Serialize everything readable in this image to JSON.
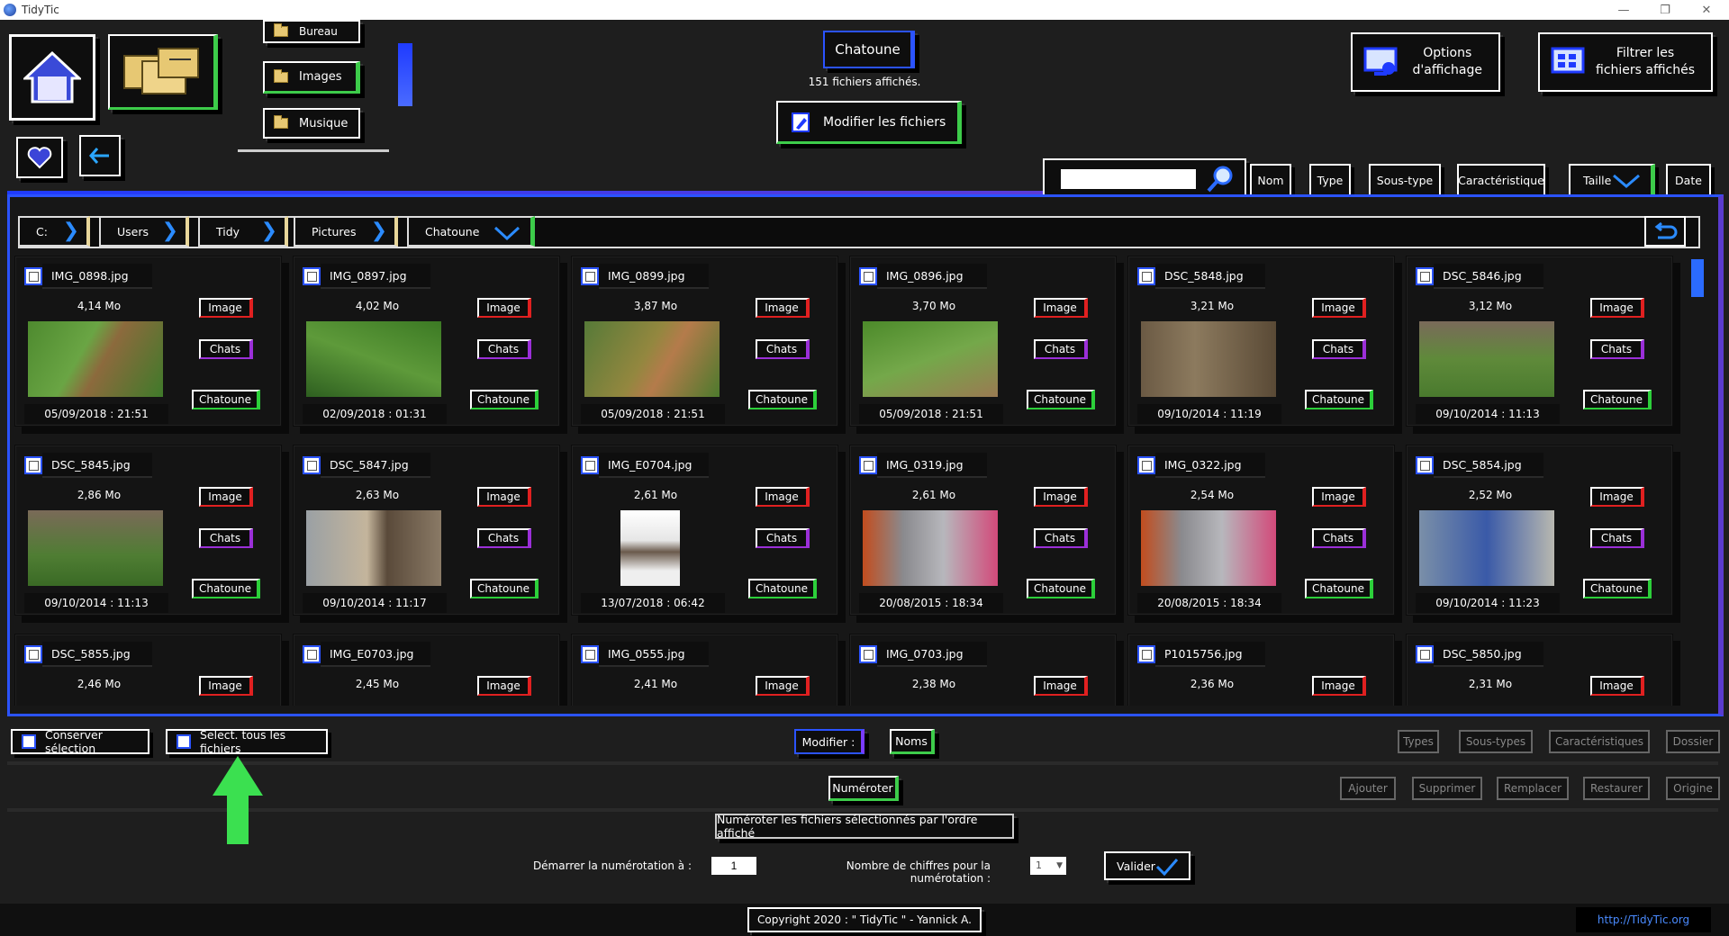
{
  "window": {
    "title": "TidyTic",
    "minimize": "—",
    "restore": "❐",
    "close": "✕"
  },
  "folders": {
    "partial": "Bureau",
    "images": "Images",
    "music": "Musique"
  },
  "current": {
    "folder": "Chatoune",
    "count_label": "151 fichiers affichés.",
    "modify": "Modifier les fichiers"
  },
  "top_right": {
    "display_options": "Options\nd'affichage",
    "filter": "Filtrer les\nfichiers affichés"
  },
  "search": {
    "value": ""
  },
  "sort": {
    "name": "Nom",
    "type": "Type",
    "subtype": "Sous-type",
    "feature": "Caractéristique",
    "size": "Taille",
    "date": "Date"
  },
  "breadcrumb": [
    "C:",
    "Users",
    "Tidy",
    "Pictures",
    "Chatoune"
  ],
  "tags": {
    "type": "Image",
    "subtype": "Chats",
    "feature": "Chatoune"
  },
  "files": [
    {
      "name": "IMG_0898.jpg",
      "size": "4,14 Mo",
      "date": "05/09/2018 : 21:51"
    },
    {
      "name": "IMG_0897.jpg",
      "size": "4,02 Mo",
      "date": "02/09/2018 : 01:31"
    },
    {
      "name": "IMG_0899.jpg",
      "size": "3,87 Mo",
      "date": "05/09/2018 : 21:51"
    },
    {
      "name": "IMG_0896.jpg",
      "size": "3,70 Mo",
      "date": "05/09/2018 : 21:51"
    },
    {
      "name": "DSC_5848.jpg",
      "size": "3,21 Mo",
      "date": "09/10/2014 : 11:19"
    },
    {
      "name": "DSC_5846.jpg",
      "size": "3,12 Mo",
      "date": "09/10/2014 : 11:13"
    },
    {
      "name": "DSC_5845.jpg",
      "size": "2,86 Mo",
      "date": "09/10/2014 : 11:13"
    },
    {
      "name": "DSC_5847.jpg",
      "size": "2,63 Mo",
      "date": "09/10/2014 : 11:17"
    },
    {
      "name": "IMG_E0704.jpg",
      "size": "2,61 Mo",
      "date": "13/07/2018 : 06:42"
    },
    {
      "name": "IMG_0319.jpg",
      "size": "2,61 Mo",
      "date": "20/08/2015 : 18:34"
    },
    {
      "name": "IMG_0322.jpg",
      "size": "2,54 Mo",
      "date": "20/08/2015 : 18:34"
    },
    {
      "name": "DSC_5854.jpg",
      "size": "2,52 Mo",
      "date": "09/10/2014 : 11:23"
    },
    {
      "name": "DSC_5855.jpg",
      "size": "2,46 Mo",
      "date": ""
    },
    {
      "name": "IMG_E0703.jpg",
      "size": "2,45 Mo",
      "date": ""
    },
    {
      "name": "IMG_0555.jpg",
      "size": "2,41 Mo",
      "date": ""
    },
    {
      "name": "IMG_0703.jpg",
      "size": "2,38 Mo",
      "date": ""
    },
    {
      "name": "P1015756.jpg",
      "size": "2,36 Mo",
      "date": ""
    },
    {
      "name": "DSC_5850.jpg",
      "size": "2,31 Mo",
      "date": ""
    }
  ],
  "bottom": {
    "keep_selection": "Conserver sélection",
    "select_all": "Select. tous les fichiers",
    "modify_label": "Modifier :",
    "names": "Noms",
    "types": "Types",
    "subtypes": "Sous-types",
    "features": "Caractéristiques",
    "folder": "Dossier",
    "number": "Numéroter",
    "add": "Ajouter",
    "remove": "Supprimer",
    "replace": "Remplacer",
    "restore": "Restaurer",
    "origin": "Origine",
    "number_desc": "Numéroter les fichiers sélectionnés par l'ordre affiché",
    "start_label": "Démarrer la numérotation à :",
    "start_value": "1",
    "digits_label": "Nombre de chiffres pour la numérotation :",
    "digits_value": "1",
    "validate": "Valider"
  },
  "footer": {
    "copyright": "Copyright 2020 : \" TidyTic \" - Yannick A.",
    "link": "http://TidyTic.org"
  }
}
